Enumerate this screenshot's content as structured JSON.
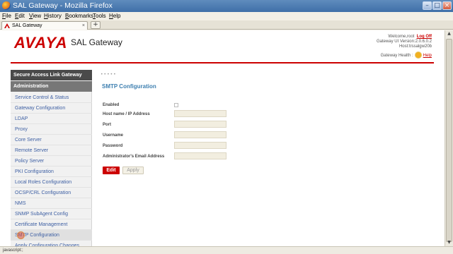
{
  "window": {
    "title": "SAL Gateway - Mozilla Firefox"
  },
  "menu": [
    "File",
    "Edit",
    "View",
    "History",
    "Bookmarks",
    "Tools",
    "Help"
  ],
  "tab": {
    "label": "SAL Gateway",
    "close": "×",
    "new": "+"
  },
  "header": {
    "logo": "AVAYA",
    "product": "SAL Gateway",
    "welcome": "Welcome,root",
    "logoff": "Log Off",
    "version": "Gateway UI Version:2.0.6.0.2",
    "host": "Host:trssalgw20b",
    "health_label": "Gateway Health :",
    "help": "Help"
  },
  "sidebar": {
    "heading": "Secure Access Link Gateway",
    "section": "Administration",
    "items": [
      "Service Control & Status",
      "Gateway Configuration",
      "LDAP",
      "Proxy",
      "Core Server",
      "Remote Server",
      "Policy Server",
      "PKI Configuration",
      "Local Roles Configuration",
      "OCSP/CRL Configuration",
      "NMS",
      "SNMP SubAgent Config",
      "Certificate Management",
      "SMTP Configuration",
      "Apply Configuration Changes"
    ]
  },
  "content": {
    "breadcrumb_dots": "•••••",
    "title": "SMTP Configuration",
    "fields": [
      "Enabled",
      "Host name / IP Address",
      "Port",
      "Username",
      "Password",
      "Administrator's Email Address"
    ],
    "edit_label": "Edit",
    "apply_label": "Apply"
  },
  "status": {
    "text": "javascript:;"
  },
  "colors": {
    "brand": "#cc0000",
    "link": "#3d5fa3",
    "title_blue": "#3d7fb0"
  }
}
